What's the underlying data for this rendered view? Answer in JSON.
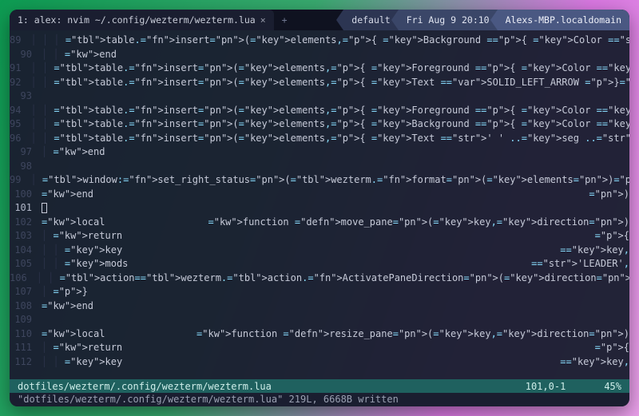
{
  "tabbar": {
    "tab_label": "1: alex: nvim ~/.config/wezterm/wezterm.lua",
    "close_glyph": "×",
    "newtab_glyph": "+",
    "status": {
      "a": "default",
      "b": "Fri Aug 9 20:10",
      "c": "Alexs-MBP.localdomain"
    }
  },
  "gutter": {
    "start": 89,
    "end": 112,
    "current": 101
  },
  "code": {
    "l89": "      table.insert(elements, { Background = { Color = 'none' } })",
    "l90": "    end",
    "l91": "    table.insert(elements, { Foreground = { Color = gradient[i] } })",
    "l92": "    table.insert(elements, { Text = SOLID_LEFT_ARROW })",
    "l93": "",
    "l94": "    table.insert(elements, { Foreground = { Color = fg } })",
    "l95": "    table.insert(elements, { Background = { Color = gradient[i] } })",
    "l96": "    table.insert(elements, { Text = ' ' .. seg .. ' ' })",
    "l97": "  end",
    "l98": "",
    "l99": "  window:set_right_status(wezterm.format(elements))",
    "l100": "end)",
    "l101_cursor": true,
    "l102": "local function move_pane(key, direction)",
    "l103": "  return {",
    "l104": "    key = key,",
    "l105": "    mods = 'LEADER',",
    "l106": "    action = wezterm.action.ActivatePaneDirection(direction),",
    "l107": "  }",
    "l108": "end",
    "l109": "",
    "l110": "local function resize_pane(key, direction)",
    "l111": "  return {",
    "l112": "    key = key,"
  },
  "statusline": {
    "file": "dotfiles/wezterm/.config/wezterm/wezterm.lua",
    "pos": "101,0-1",
    "pct": "45%"
  },
  "msgline": "\"dotfiles/wezterm/.config/wezterm/wezterm.lua\" 219L, 6668B written"
}
